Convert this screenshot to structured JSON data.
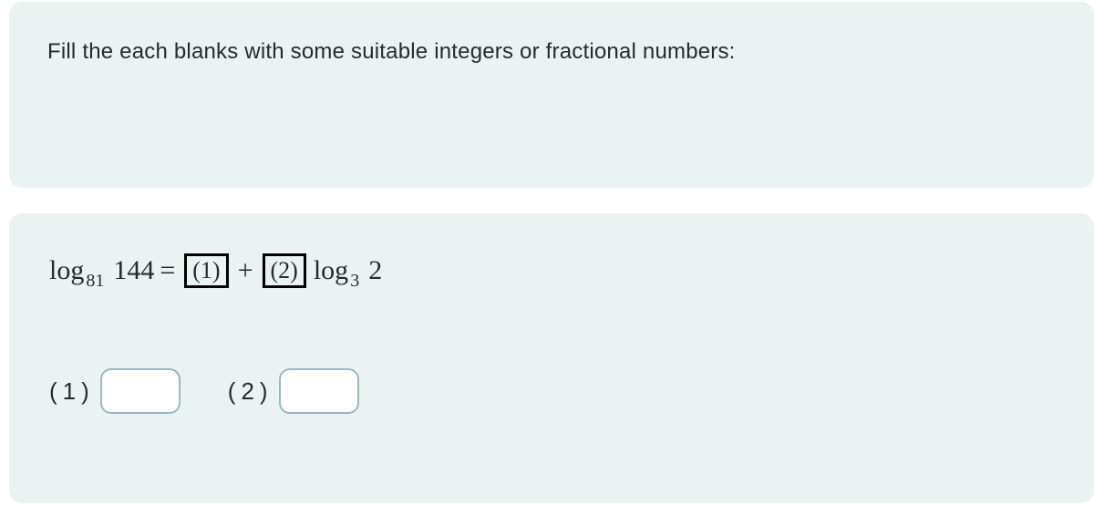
{
  "question": {
    "prompt": "Fill the each blanks with some suitable integers or fractional numbers:"
  },
  "equation": {
    "log_label": "log",
    "base1": "81",
    "arg1": "144",
    "equals": "=",
    "blank1_label": "(1)",
    "plus": "+",
    "blank2_label": "(2)",
    "log_label2": "log",
    "base2": "3",
    "arg2": "2"
  },
  "answers": {
    "a1": {
      "label": "(1)",
      "value": ""
    },
    "a2": {
      "label": "(2)",
      "value": ""
    }
  }
}
